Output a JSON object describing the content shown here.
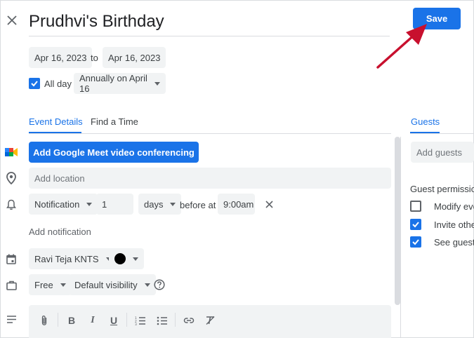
{
  "event": {
    "title": "Prudhvi's Birthday",
    "save_label": "Save",
    "start_date": "Apr 16, 2023",
    "to_label": "to",
    "end_date": "Apr 16, 2023",
    "all_day_label": "All day",
    "all_day_checked": true,
    "recurrence": "Annually on April 16"
  },
  "tabs": {
    "event_details": "Event Details",
    "find_a_time": "Find a Time",
    "guests": "Guests"
  },
  "details": {
    "meet_button": "Add Google Meet video conferencing",
    "location_placeholder": "Add location",
    "notification_type": "Notification",
    "notification_value": "1",
    "notification_unit": "days",
    "before_at_label": "before at",
    "notification_time": "9:00am",
    "add_notification": "Add notification",
    "calendar_owner": "Ravi Teja KNTS",
    "availability": "Free",
    "visibility": "Default visibility"
  },
  "guests": {
    "placeholder": "Add guests",
    "permissions_label": "Guest permission",
    "permissions": [
      {
        "label": "Modify eve",
        "checked": false
      },
      {
        "label": "Invite othe",
        "checked": true
      },
      {
        "label": "See guest",
        "checked": true
      }
    ]
  },
  "colors": {
    "accent": "#1a73e8",
    "arrow": "#c8102e",
    "chip_bg": "#f1f3f4",
    "calendar_color": "#000000"
  }
}
